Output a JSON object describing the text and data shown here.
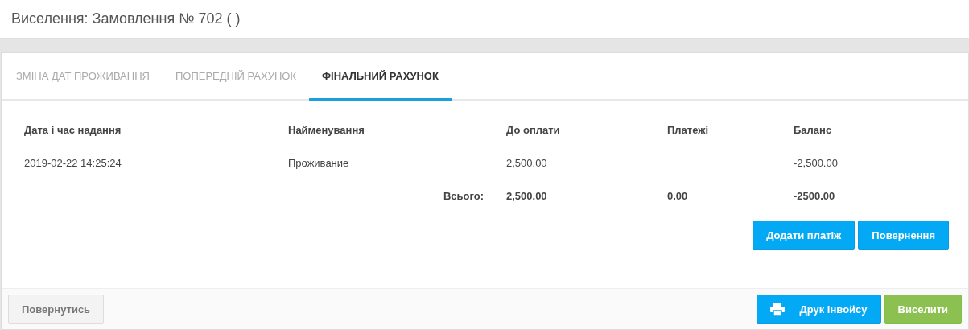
{
  "title": "Виселення: Замовлення № 702 ( )",
  "tabs": [
    {
      "label": "ЗМІНА ДАТ ПРОЖИВАННЯ",
      "selected": false
    },
    {
      "label": "ПОПЕРЕДНІЙ РАХУНОК",
      "selected": false
    },
    {
      "label": "ФІНАЛЬНИЙ РАХУНОК",
      "selected": true
    }
  ],
  "table": {
    "columns": [
      "Дата і час надання",
      "Найменування",
      "До оплати",
      "Платежі",
      "Баланс"
    ],
    "rows": [
      [
        "2019-02-22 14:25:24",
        "Проживание",
        "2,500.00",
        "",
        "-2,500.00"
      ]
    ],
    "total": {
      "label": "Всього:",
      "values": [
        "2,500.00",
        "0.00",
        "-2500.00"
      ]
    }
  },
  "actions": [
    "Додати платіж",
    "Повернення"
  ],
  "footer_buttons": [
    {
      "label": "Повернутись",
      "kind": "default"
    },
    {
      "label": "Друк інвойсу",
      "kind": "print"
    },
    {
      "label": "Виселити",
      "kind": "success"
    }
  ]
}
